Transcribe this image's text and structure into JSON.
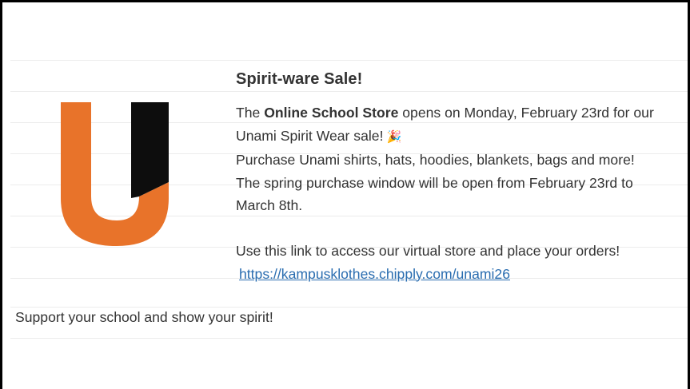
{
  "post": {
    "heading": "Spirit-ware Sale!",
    "line1_pre": "The ",
    "line1_bold": "Online School Store",
    "line1_post": " opens on Monday, February 23rd for our",
    "line2": "Unami Spirit Wear sale!",
    "emoji": "🎉",
    "line3": "Purchase Unami shirts, hats, hoodies, blankets, bags and more!",
    "line4": "The spring purchase window will be open from February 23rd to",
    "line5": "March 8th.",
    "line6": "Use this link to access our virtual store and place your orders!",
    "link": "https://kampusklothes.chipply.com/unami26",
    "footer": "Support your school and show your spirit!"
  },
  "colors": {
    "logo_orange": "#E8732A",
    "logo_black": "#0d0d0d",
    "link": "#2a6db0"
  },
  "icons": {
    "logo": "unami-u-logo",
    "emoji": "party-popper-icon"
  }
}
